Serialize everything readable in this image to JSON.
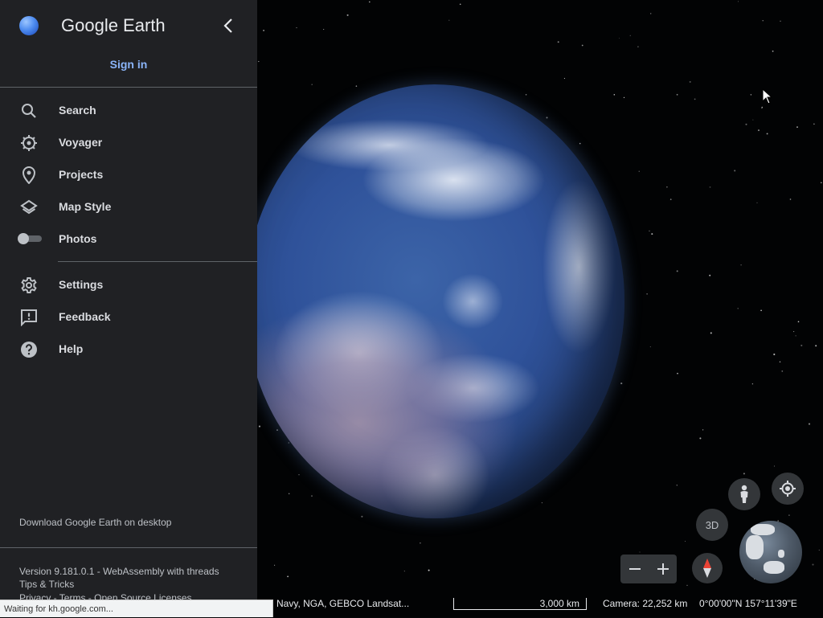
{
  "app": {
    "brand": "Google Earth",
    "sign_in": "Sign in"
  },
  "nav": {
    "search": "Search",
    "voyager": "Voyager",
    "projects": "Projects",
    "map_style": "Map Style",
    "photos": "Photos",
    "photos_enabled": false,
    "settings": "Settings",
    "feedback": "Feedback",
    "help": "Help"
  },
  "footer": {
    "download": "Download Google Earth on desktop",
    "version": "Version 9.181.0.1 - WebAssembly with threads",
    "tips": "Tips & Tricks",
    "privacy": "Privacy",
    "terms": "Terms",
    "open_source": "Open Source Licenses",
    "sep": " - "
  },
  "status": {
    "loading": "Waiting for kh.google.com..."
  },
  "map": {
    "attribution": "Navy, NGA, GEBCO   Landsat...",
    "scale": "3,000 km",
    "camera": "Camera: 22,252 km",
    "coordinates": "0°00'00\"N 157°11'39\"E",
    "button_3d": "3D"
  },
  "colors": {
    "sidebar_bg": "#202124",
    "accent": "#8ab4f8",
    "compass_north": "#ea4335"
  },
  "icons": {
    "search": "search-icon",
    "voyager": "voyager-wheel-icon",
    "projects": "map-pin-icon",
    "map_style": "layers-icon",
    "settings": "gear-icon",
    "feedback": "feedback-icon",
    "help": "help-icon",
    "collapse": "chevron-left-icon",
    "pegman": "pegman-icon",
    "locate": "crosshair-icon",
    "compass": "compass-icon",
    "zoom_out": "minus-icon",
    "zoom_in": "plus-icon"
  }
}
